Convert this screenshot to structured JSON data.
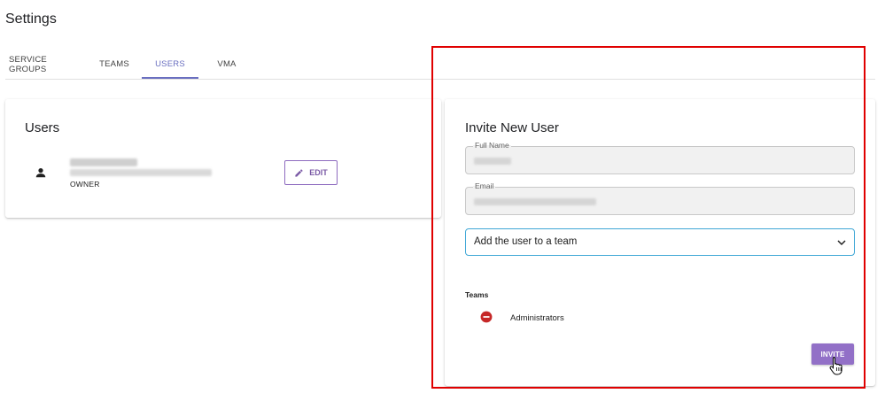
{
  "page": {
    "title": "Settings"
  },
  "tabs": [
    {
      "label": "SERVICE GROUPS",
      "active": false
    },
    {
      "label": "TEAMS",
      "active": false
    },
    {
      "label": "USERS",
      "active": true
    },
    {
      "label": "VMA",
      "active": false
    }
  ],
  "users_card": {
    "title": "Users",
    "user": {
      "role": "OWNER",
      "icon": "person-icon"
    },
    "edit_label": "EDIT"
  },
  "invite_card": {
    "title": "Invite New User",
    "full_name_label": "Full Name",
    "email_label": "Email",
    "team_select_value": "Add the user to a team",
    "teams_label": "Teams",
    "teams": [
      {
        "name": "Administrators",
        "icon": "remove-circle-icon"
      }
    ],
    "invite_label": "INVITE"
  },
  "colors": {
    "accent": "#6a6fc0",
    "button": "#9270c7",
    "highlight": "#e00000",
    "remove": "#c62828",
    "focus": "#3fa7d6"
  }
}
